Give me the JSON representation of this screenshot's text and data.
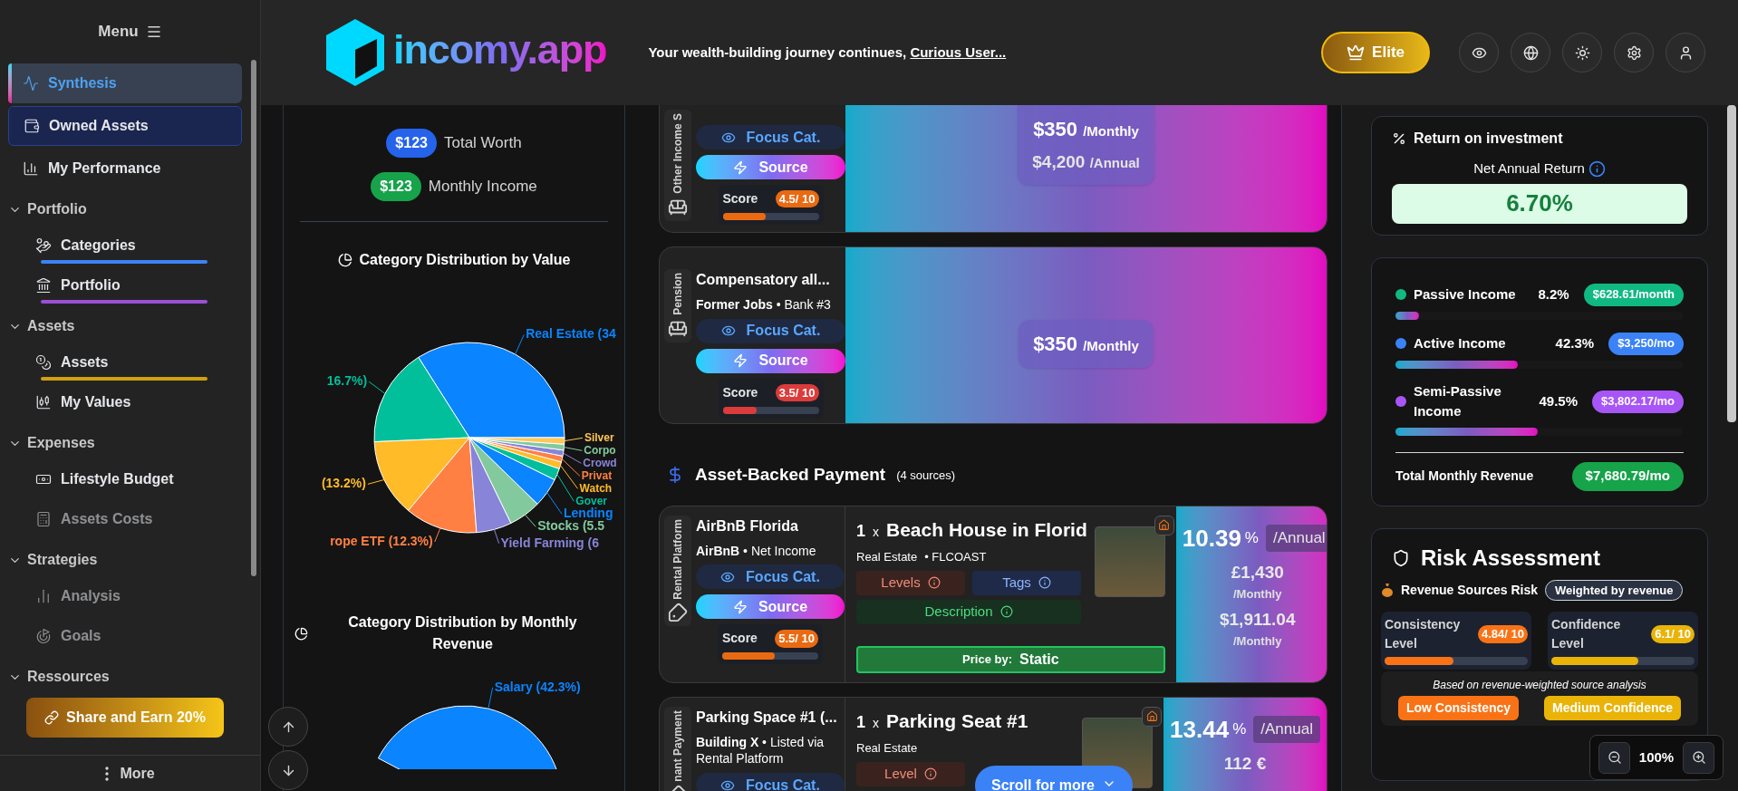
{
  "sidebar": {
    "title": "Menu",
    "items": [
      {
        "kind": "item",
        "label": "Synthesis",
        "selected": true,
        "highlighted": false,
        "disabled": false
      },
      {
        "kind": "item",
        "label": "Owned Assets",
        "selected": false,
        "highlighted": true,
        "disabled": false
      },
      {
        "kind": "item",
        "label": "My Performance",
        "selected": false,
        "highlighted": false,
        "disabled": false
      },
      {
        "kind": "section",
        "label": "Portfolio",
        "expanded": true,
        "children": [
          {
            "label": "Categories",
            "selected": false,
            "disabled": false,
            "color": "#3b82f6"
          },
          {
            "label": "Portfolio",
            "selected": false,
            "disabled": false,
            "color": "#9b4fd6"
          }
        ]
      },
      {
        "kind": "section",
        "label": "Assets",
        "expanded": true,
        "children": [
          {
            "label": "Assets",
            "selected": false,
            "disabled": false,
            "color": "#d1a00f"
          },
          {
            "label": "My Values",
            "selected": false,
            "disabled": false
          }
        ]
      },
      {
        "kind": "section",
        "label": "Expenses",
        "expanded": true,
        "children": [
          {
            "label": "Lifestyle Budget",
            "selected": false,
            "disabled": false
          },
          {
            "label": "Assets Costs",
            "selected": false,
            "disabled": true
          }
        ]
      },
      {
        "kind": "section",
        "label": "Strategies",
        "expanded": true,
        "children": [
          {
            "label": "Analysis",
            "selected": false,
            "disabled": true
          },
          {
            "label": "Goals",
            "selected": false,
            "disabled": true
          }
        ]
      },
      {
        "kind": "section",
        "label": "Ressources",
        "expanded": true
      }
    ],
    "share_button": "Share and Earn 20%",
    "more": "More"
  },
  "header": {
    "logo": "incomy.app",
    "tagline": "Your wealth-building journey continues, ",
    "user_link": "Curious User...",
    "plan_button": "Elite"
  },
  "summary": [
    {
      "value": "$123",
      "label": "Total Worth",
      "color": "#2563eb"
    },
    {
      "value": "$123",
      "label": "Monthly Income",
      "color": "#16a34a"
    }
  ],
  "charts": [
    {
      "chart_data": {
        "type": "pie",
        "title": "Category Distribution by Value",
        "categories": [
          "Real Estate (34",
          "16.7%)",
          "(13.2%)",
          "rope ETF (12.3%)",
          "Yield Farming (6",
          "Stocks (5.5",
          "Lending",
          "Gover",
          "Watch",
          "Privat",
          "Crowd",
          "Corpo",
          "Silver"
        ],
        "values": [
          34,
          16.7,
          13.2,
          12.3,
          6,
          5.5,
          5,
          2,
          1.2,
          1,
          1,
          1,
          1.1
        ],
        "colors": [
          "#0a84ff",
          "#00bf9a",
          "#ffbb28",
          "#ff8042",
          "#8884d8",
          "#82ca9d",
          "#0a84ff",
          "#00bf9a",
          "#ffbb28",
          "#ff8042",
          "#8884d8",
          "#82ca9d",
          "#ffc658"
        ]
      }
    },
    {
      "chart_data": {
        "type": "pie",
        "title": "Category Distribution by Monthly Revenue",
        "categories": [
          "Salary (42.3%)"
        ],
        "values": [
          42.3
        ],
        "colors": [
          "#0a84ff"
        ]
      }
    }
  ],
  "income_cards": [
    {
      "kind": "plain",
      "category": "Other Income S",
      "clipped": true,
      "focus_label": "Focus Cat.",
      "source_label": "Source",
      "score_label": "Score",
      "score": "4.5/ 10",
      "level": 0.45,
      "color": "#ea6a12",
      "amounts": [
        {
          "value": "$350",
          "unit": "/Monthly"
        },
        {
          "value": "$4,200",
          "unit": "/Annual"
        }
      ]
    },
    {
      "kind": "plain",
      "category": "Pension",
      "clipped": false,
      "title": "Compensatory all...",
      "subtitle": "**Former Jobs** • Bank #3",
      "focus_label": "Focus Cat.",
      "source_label": "Source",
      "score_label": "Score",
      "score": "3.5/ 10",
      "level": 0.35,
      "color": "#dc3b3b",
      "amounts": [
        {
          "value": "$350",
          "unit": "/Monthly"
        }
      ]
    }
  ],
  "section": {
    "title": "Asset-Backed Payment",
    "count": "(4 sources)"
  },
  "asset_cards": [
    {
      "category": "Rental Platform",
      "title": "AirBnB Florida",
      "subtitle": "**AirBnB** • Net Income",
      "focus_label": "Focus Cat.",
      "source_label": "Source",
      "score_label": "Score",
      "score": "5.5/ 10",
      "level": 0.55,
      "color": "#ea6a12",
      "quantity": "1",
      "times": "x",
      "asset": "Beach House in Florid",
      "asset_type": "Real Estate",
      "asset_code": "• FLCOAST",
      "buttons": [
        {
          "kind": "levels",
          "label": "Levels"
        },
        {
          "kind": "tags",
          "label": "Tags"
        },
        {
          "kind": "description",
          "label": "Description"
        }
      ],
      "price_label": "Price by:",
      "price_mode": "Static",
      "yield": "10.39",
      "yield_unit": "%",
      "period": "/Annual",
      "amounts": [
        {
          "value": "£1,430",
          "unit": "/Monthly"
        },
        {
          "value": "$1,911.04",
          "unit": "/Monthly"
        }
      ]
    },
    {
      "category": "nant Payment",
      "title": "Parking Space #1 (...",
      "subtitle": "**Building X** • Listed via Rental Platform",
      "focus_label": "Focus Cat.",
      "quantity": "1",
      "times": "x",
      "asset": "Parking Seat #1",
      "asset_type": "Real Estate",
      "buttons": [
        {
          "kind": "levels",
          "label": "Level"
        }
      ],
      "yield": "13.44",
      "yield_unit": "%",
      "period": "/Annual",
      "amounts": [
        {
          "value": "112 €"
        }
      ]
    }
  ],
  "scroll_hint": "Scroll for more",
  "roi": {
    "title": "Return on investment",
    "label": "Net Annual Return",
    "value": "6.70%"
  },
  "income_breakdown": {
    "rows": [
      {
        "label": "Passive Income",
        "pct": "8.2%",
        "amount": "$628.61/month",
        "color": "#10b981",
        "level": 0.082
      },
      {
        "label": "Active Income",
        "pct": "42.3%",
        "amount": "$3,250/mo",
        "color": "#3b82f6",
        "level": 0.423
      },
      {
        "label": "Semi-Passive Income",
        "pct": "49.5%",
        "amount": "$3,802.17/mo",
        "color": "#a855f7",
        "level": 0.495
      }
    ],
    "total_label": "Total Monthly Revenue",
    "total": "$7,680.79/mo"
  },
  "risk": {
    "title": "Risk Assessment",
    "subtitle": "Revenue Sources Risk",
    "badge": "Weighted by revenue",
    "metrics": [
      {
        "label": "Consistency Level",
        "score": "4.84/ 10",
        "level": 0.484,
        "color": "#f97316"
      },
      {
        "label": "Confidence Level",
        "score": "6.1/ 10",
        "level": 0.61,
        "color": "#eab308"
      }
    ],
    "note": "Based on revenue-weighted source analysis",
    "tags": [
      {
        "label": "Low Consistency",
        "color": "#f97316"
      },
      {
        "label": "Medium Confidence",
        "color": "#eab308"
      }
    ]
  },
  "zoom": {
    "value": "100%"
  }
}
